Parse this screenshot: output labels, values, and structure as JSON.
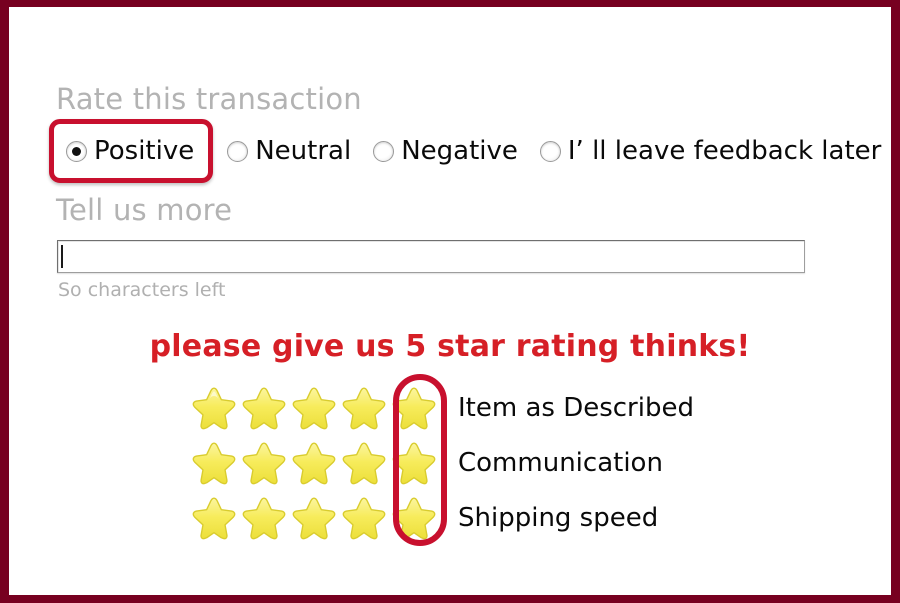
{
  "frame": {
    "border_color": "#770020",
    "background": "#ffffff"
  },
  "rate_section": {
    "heading": "Rate this transaction",
    "selected_value": "Positive",
    "highlight_color": "#c8102e",
    "options": [
      {
        "label": "Positive",
        "checked": true,
        "highlighted": true,
        "name": "positive"
      },
      {
        "label": "Neutral",
        "checked": false,
        "highlighted": false,
        "name": "neutral"
      },
      {
        "label": "Negative",
        "checked": false,
        "highlighted": false,
        "name": "negative"
      },
      {
        "label": "I’  ll leave feedback later",
        "checked": false,
        "highlighted": false,
        "name": "leave-feedback-later"
      }
    ]
  },
  "tell_us_more": {
    "heading": "Tell us more",
    "input_value": "",
    "input_placeholder": "",
    "characters_left_text": "So characters left"
  },
  "promo": {
    "text": "please give us 5 star rating thinks!",
    "color": "#d61f26"
  },
  "ratings": {
    "star_color": "#f5e64a",
    "stars_per_row": 5,
    "highlighted_column_index": 5,
    "highlight_color": "#c8102e",
    "rows": [
      {
        "label": "Item as Described",
        "stars": 5,
        "name": "item-as-described"
      },
      {
        "label": "Communication",
        "stars": 5,
        "name": "communication"
      },
      {
        "label": "Shipping speed",
        "stars": 5,
        "name": "shipping-speed"
      }
    ]
  }
}
